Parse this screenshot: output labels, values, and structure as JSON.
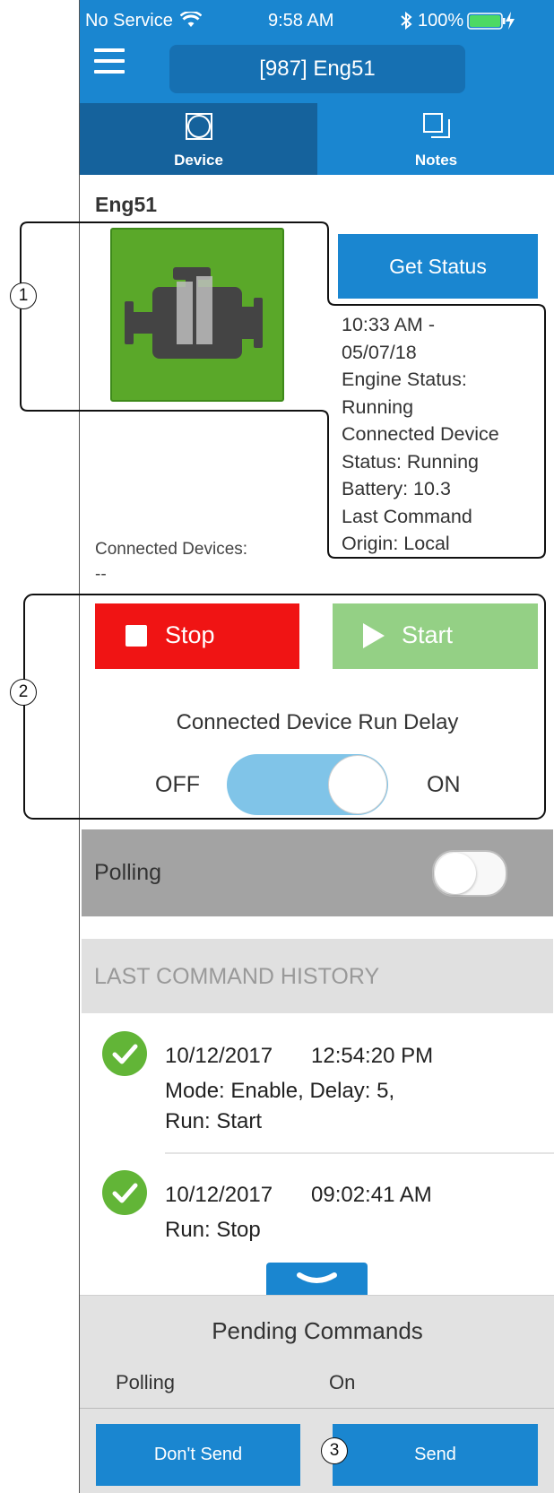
{
  "status_bar": {
    "carrier": "No Service",
    "time": "9:58 AM",
    "battery": "100%",
    "wifi_icon": "wifi-icon",
    "bluetooth_icon": "bluetooth-icon"
  },
  "header": {
    "title": "[987] Eng51",
    "menu_icon": "hamburger-icon"
  },
  "tabs": [
    {
      "label": "Device",
      "icon": "device-icon",
      "active": true
    },
    {
      "label": "Notes",
      "icon": "notes-icon",
      "active": false
    }
  ],
  "device": {
    "name": "Eng51",
    "engine_icon": "engine-icon",
    "status_color": "#5aa829",
    "get_status_label": "Get Status",
    "status_lines": [
      "10:33 AM -",
      "05/07/18",
      "Engine Status:",
      "Running",
      "Connected Device",
      "Status: Running",
      "Battery: 10.3",
      "Last Command",
      "Origin: Local"
    ],
    "connected_devices_label": "Connected Devices:",
    "connected_devices_value": "--"
  },
  "controls": {
    "stop_label": "Stop",
    "start_label": "Start",
    "run_delay_label": "Connected Device Run Delay",
    "off_label": "OFF",
    "on_label": "ON",
    "run_delay_on": true
  },
  "polling": {
    "label": "Polling",
    "on": false
  },
  "history": {
    "header": "LAST COMMAND HISTORY",
    "entries": [
      {
        "date": "10/12/2017",
        "time": "12:54:20 PM",
        "desc_lines": [
          "Mode: Enable, Delay: 5,",
          "Run: Start"
        ]
      },
      {
        "date": "10/12/2017",
        "time": "09:02:41 AM",
        "desc_lines": [
          "Run: Stop"
        ]
      }
    ]
  },
  "pending": {
    "title": "Pending Commands",
    "key": "Polling",
    "value": "On"
  },
  "footer": {
    "dont_send_label": "Don't Send",
    "send_label": "Send"
  },
  "callouts": [
    "1",
    "2",
    "3"
  ],
  "colors": {
    "brand_blue": "#1a86d0",
    "stop_red": "#f01414",
    "start_green": "#94d085",
    "check_green": "#62b537"
  }
}
